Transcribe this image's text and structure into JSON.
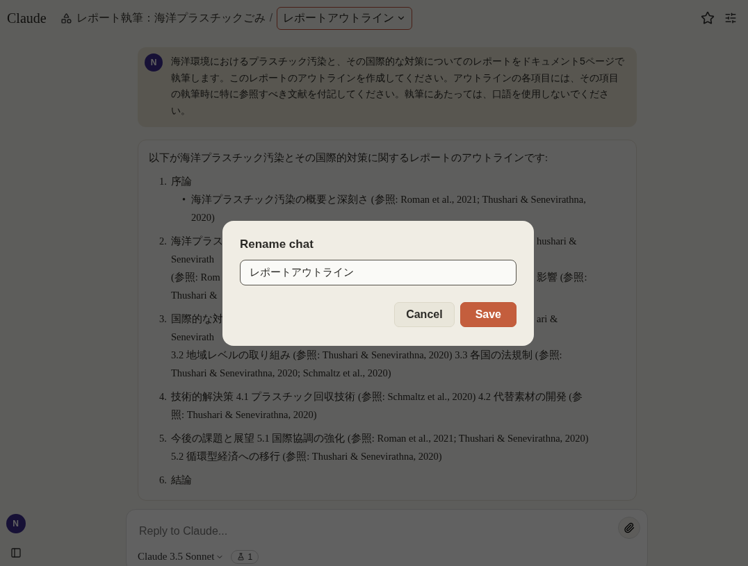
{
  "header": {
    "logo": "Claude",
    "project": "レポート執筆：海洋プラスチックごみ",
    "separator": "/",
    "chat_title": "レポートアウトライン"
  },
  "user_message": {
    "avatar": "N",
    "text": "海洋環境におけるプラスチック汚染と、その国際的な対策についてのレポートをドキュメント5ページで執筆します。このレポートのアウトラインを作成してください。アウトラインの各項目には、その項目の執筆時に特に参照すべき文献を付記してください。執筆にあたっては、口語を使用しないでください。"
  },
  "assistant_message": {
    "intro": "以下が海洋プラスチック汚染とその国際的対策に関するレポートのアウトラインです:",
    "items": [
      {
        "number": "1.",
        "lines": [
          {
            "left": "序論"
          }
        ],
        "bullets": [
          {
            "marker": "•",
            "text": "海洋プラスチック汚染の概要と深刻さ (参照: Roman et al., 2021; Thushari & Senevirathna, 2020)"
          }
        ]
      },
      {
        "number": "2.",
        "lines": [
          {
            "left": "海洋プラス",
            "right": "hushari &"
          },
          {
            "left": "Senevirath"
          },
          {
            "left": "(参照: Rom",
            "right": "影響 (参照:"
          },
          {
            "left": "Thushari &"
          }
        ]
      },
      {
        "number": "3.",
        "lines": [
          {
            "left": "国際的な対",
            "right": "ari &"
          },
          {
            "left": "Senevirath"
          },
          {
            "left": "3.2 地域レベルの取り組み (参照: Thushari & Senevirathna, 2020) 3.3 各国の法規制 (参照: Thushari & Senevirathna, 2020; Schmaltz et al., 2020)"
          }
        ]
      },
      {
        "number": "4.",
        "lines": [
          {
            "left": "技術的解決策 4.1 プラスチック回収技術 (参照: Schmaltz et al., 2020) 4.2 代替素材の開発 (参照: Thushari & Senevirathna, 2020)"
          }
        ]
      },
      {
        "number": "5.",
        "lines": [
          {
            "left": "今後の課題と展望 5.1 国際協調の強化 (参照: Roman et al., 2021; Thushari & Senevirathna, 2020) 5.2 循環型経済への移行 (参照: Thushari & Senevirathna, 2020)"
          }
        ]
      },
      {
        "number": "6.",
        "lines": [
          {
            "left": "結論"
          }
        ]
      }
    ]
  },
  "sidebar": {
    "avatar": "N"
  },
  "composer": {
    "placeholder": "Reply to Claude...",
    "model": "Claude 3.5 Sonnet",
    "count": "1"
  },
  "dialog": {
    "title": "Rename chat",
    "value": "レポートアウトライン",
    "buttons": [
      {
        "label": "Cancel",
        "kind": "secondary"
      },
      {
        "label": "Save",
        "kind": "primary"
      }
    ]
  }
}
